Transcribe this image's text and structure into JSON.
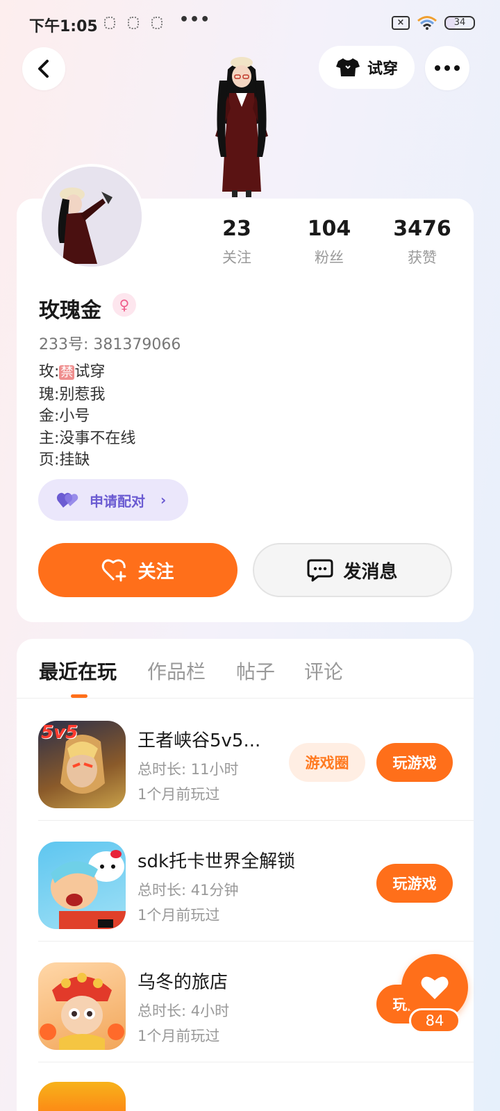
{
  "status_bar": {
    "time": "下午1:05",
    "more": "•••",
    "battery": "34"
  },
  "header": {
    "tryon_label": "试穿"
  },
  "profile": {
    "stats": [
      {
        "value": "23",
        "label": "关注"
      },
      {
        "value": "104",
        "label": "粉丝"
      },
      {
        "value": "3476",
        "label": "获赞"
      }
    ],
    "username": "玫瑰金",
    "gender_symbol": "♀",
    "user_id": "233号: 381379066",
    "bio": {
      "line1_prefix": "玫:",
      "line1_badge": "禁",
      "line1_suffix": "试穿",
      "line2": "瑰:别惹我",
      "line3": "金:小号",
      "line4": "主:没事不在线",
      "line5": "页:挂缺"
    },
    "pair_label": "申请配对",
    "follow_label": "关注",
    "message_label": "发消息"
  },
  "tabs": [
    "最近在玩",
    "作品栏",
    "帖子",
    "评论"
  ],
  "games": [
    {
      "title": "王者峡谷5v5...",
      "duration": "总时长: 11小时",
      "last_played": "1个月前玩过",
      "circle_label": "游戏圈",
      "play_label": "玩游戏",
      "icon_text": "5v5"
    },
    {
      "title": "sdk托卡世界全解锁",
      "duration": "总时长: 41分钟",
      "last_played": "1个月前玩过",
      "play_label": "玩游戏"
    },
    {
      "title": "乌冬的旅店",
      "duration": "总时长: 4小时",
      "last_played": "1个月前玩过",
      "play_label": "玩游戏"
    }
  ],
  "like_fab": {
    "count": "84"
  },
  "colors": {
    "accent": "#ff6f1a",
    "pair": "#6b5bd2",
    "muted": "#999999"
  }
}
